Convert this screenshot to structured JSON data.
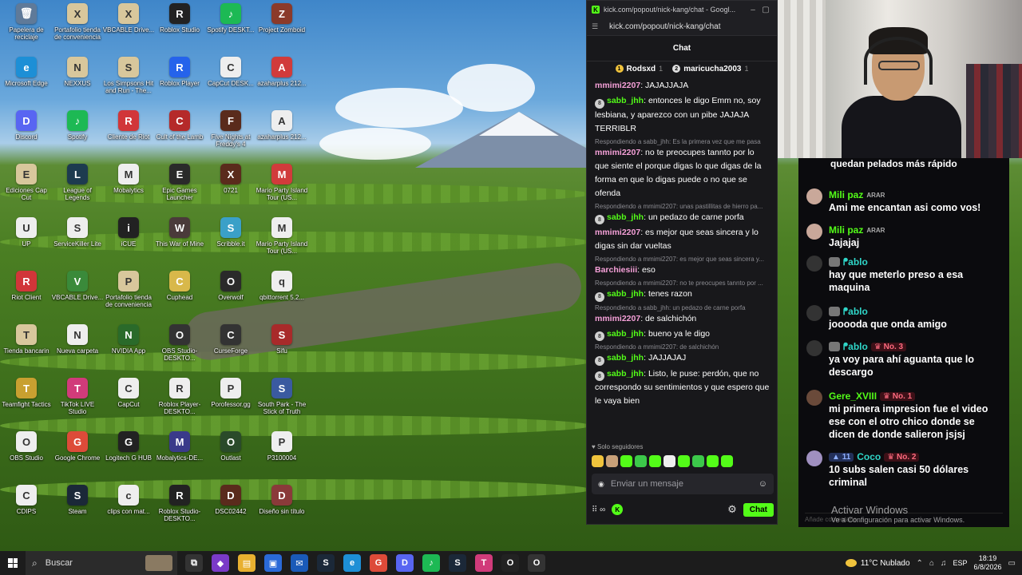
{
  "desktop": {
    "icons": [
      {
        "label": "Papelera de reciclaje",
        "glyph": "🗑",
        "color": "#5f7a99"
      },
      {
        "label": "Portafolio tienda de conveniencia",
        "glyph": "X",
        "color": "#d8c79c"
      },
      {
        "label": "VBCABLE Drive...",
        "glyph": "X",
        "color": "#d8c79c"
      },
      {
        "label": "Roblox Studio",
        "glyph": "R",
        "color": "#222"
      },
      {
        "label": "Spotify DESKT...",
        "glyph": "♪",
        "color": "#1db954"
      },
      {
        "label": "Project Zomboid",
        "glyph": "Z",
        "color": "#8b3a2a"
      },
      {
        "label": "Microsoft Edge",
        "glyph": "e",
        "color": "#1d8fd6"
      },
      {
        "label": "NEXXUS",
        "glyph": "N",
        "color": "#d8c79c"
      },
      {
        "label": "Los Simpsons Hit and Run - The...",
        "glyph": "S",
        "color": "#d8c79c"
      },
      {
        "label": "Roblox Player",
        "glyph": "R",
        "color": "#2563eb"
      },
      {
        "label": "CapCut DESK...",
        "glyph": "C",
        "color": "#eee"
      },
      {
        "label": "azaharplus 212...",
        "glyph": "A",
        "color": "#d13b3b"
      },
      {
        "label": "Discord",
        "glyph": "D",
        "color": "#5865f2"
      },
      {
        "label": "Spotify",
        "glyph": "♪",
        "color": "#1db954"
      },
      {
        "label": "Cliente de Riot",
        "glyph": "R",
        "color": "#d13639"
      },
      {
        "label": "Cult of the Lamb",
        "glyph": "C",
        "color": "#b52a2a"
      },
      {
        "label": "Five Nights at Freddy's 4",
        "glyph": "F",
        "color": "#5a2b1c"
      },
      {
        "label": "azaharplus 212...",
        "glyph": "A",
        "color": "#eee"
      },
      {
        "label": "Ediciones Cap Cut",
        "glyph": "E",
        "color": "#d8c79c"
      },
      {
        "label": "League of Legends",
        "glyph": "L",
        "color": "#1d3b4f"
      },
      {
        "label": "Mobalytics",
        "glyph": "M",
        "color": "#eee"
      },
      {
        "label": "Epic Games Launcher",
        "glyph": "E",
        "color": "#2a2a2a"
      },
      {
        "label": "0721",
        "glyph": "X",
        "color": "#5a2b1c"
      },
      {
        "label": "Mario Party Island Tour (US...",
        "glyph": "M",
        "color": "#d13b3b"
      },
      {
        "label": "UP",
        "glyph": "U",
        "color": "#eee"
      },
      {
        "label": "ServiceKiller Lite",
        "glyph": "S",
        "color": "#eee"
      },
      {
        "label": "iCUE",
        "glyph": "i",
        "color": "#222"
      },
      {
        "label": "This War of Mine",
        "glyph": "W",
        "color": "#4a3a3a"
      },
      {
        "label": "Scribble.it",
        "glyph": "S",
        "color": "#3aa0c8"
      },
      {
        "label": "Mario Party Island Tour (US...",
        "glyph": "M",
        "color": "#eee"
      },
      {
        "label": "Riot Client",
        "glyph": "R",
        "color": "#d13639"
      },
      {
        "label": "VBCABLE Drive...",
        "glyph": "V",
        "color": "#3a8a3a"
      },
      {
        "label": "Portafolio tienda de conveniencia",
        "glyph": "P",
        "color": "#d8c79c"
      },
      {
        "label": "Cuphead",
        "glyph": "C",
        "color": "#d8b84a"
      },
      {
        "label": "Overwolf",
        "glyph": "O",
        "color": "#2a2a2a"
      },
      {
        "label": "qbittorrent 5.2...",
        "glyph": "q",
        "color": "#eee"
      },
      {
        "label": "Tienda bancarin",
        "glyph": "T",
        "color": "#d8c79c"
      },
      {
        "label": "Nueva carpeta",
        "glyph": "N",
        "color": "#eee"
      },
      {
        "label": "NVIDIA App",
        "glyph": "N",
        "color": "#2a6a2a"
      },
      {
        "label": "OBS Studio-DESKTO...",
        "glyph": "O",
        "color": "#333"
      },
      {
        "label": "CurseForge",
        "glyph": "C",
        "color": "#333"
      },
      {
        "label": "Sifu",
        "glyph": "S",
        "color": "#a82a2a"
      },
      {
        "label": "Teamfight Tactics",
        "glyph": "T",
        "color": "#c8a030"
      },
      {
        "label": "TikTok LIVE Studio",
        "glyph": "T",
        "color": "#d13b7a"
      },
      {
        "label": "CapCut",
        "glyph": "C",
        "color": "#eee"
      },
      {
        "label": "Roblox Player-DESKTO...",
        "glyph": "R",
        "color": "#eee"
      },
      {
        "label": "Porofessor.gg",
        "glyph": "P",
        "color": "#eee"
      },
      {
        "label": "South Park - The Stick of Truth",
        "glyph": "S",
        "color": "#3a5aa0"
      },
      {
        "label": "OBS Studio",
        "glyph": "O",
        "color": "#eee"
      },
      {
        "label": "Google Chrome",
        "glyph": "G",
        "color": "#dd4b39"
      },
      {
        "label": "Logitech G HUB",
        "glyph": "G",
        "color": "#222"
      },
      {
        "label": "Mobalytics-DE...",
        "glyph": "M",
        "color": "#3a3a8a"
      },
      {
        "label": "Outlast",
        "glyph": "O",
        "color": "#2a4a2a"
      },
      {
        "label": "P3100004",
        "glyph": "P",
        "color": "#eee"
      },
      {
        "label": "CDIPS",
        "glyph": "C",
        "color": "#eee"
      },
      {
        "label": "Steam",
        "glyph": "S",
        "color": "#1b2838"
      },
      {
        "label": "clips con mat...",
        "glyph": "c",
        "color": "#eee"
      },
      {
        "label": "Roblox Studio-DESKTO...",
        "glyph": "R",
        "color": "#222"
      },
      {
        "label": "DSC02442",
        "glyph": "D",
        "color": "#5a2b1c"
      },
      {
        "label": "Diseño sin título",
        "glyph": "D",
        "color": "#8a3a3a"
      }
    ]
  },
  "kick_window": {
    "title": "kick.com/popout/nick-kang/chat - Googl...",
    "url": "kick.com/popout/nick-kang/chat",
    "header": "Chat",
    "pinned": [
      {
        "name": "Rodsxd",
        "count": "1",
        "color": "#f0c33c",
        "glyph": "1"
      },
      {
        "name": "maricucha2003",
        "count": "1",
        "color": "#e0e0e0",
        "glyph": "2"
      }
    ],
    "messages": [
      {
        "reply": "",
        "badge": "",
        "user": "mmimi2207",
        "user_color": "#f5a0d8",
        "text": "JAJAJJAJA"
      },
      {
        "reply": "",
        "badge": "8",
        "user": "sabb_jhh",
        "user_color": "#53fc18",
        "text": "entonces le digo Emm no, soy lesbiana, y aparezco con un pibe JAJAJA TERRIBLR"
      },
      {
        "reply": "Respondiendo a sabb_jhh: Es la primera vez que me pasa",
        "badge": "",
        "user": "mmimi2207",
        "user_color": "#f5a0d8",
        "text": "no te preocupes tannto por lo que siente el porque digas lo que digas de la forma en que lo digas puede o no que se ofenda"
      },
      {
        "reply": "Respondiendo a mmimi2207: unas pastillitas de hierro pa...",
        "badge": "8",
        "user": "sabb_jhh",
        "user_color": "#53fc18",
        "text": "un pedazo de carne porfa"
      },
      {
        "reply": "",
        "badge": "",
        "user": "mmimi2207",
        "user_color": "#f5a0d8",
        "text": "es mejor que seas sincera y lo digas sin dar vueltas"
      },
      {
        "reply": "Respondiendo a mmimi2207: es mejor que seas sincera y...",
        "badge": "",
        "user": "Barchiesiii",
        "user_color": "#f5a0d8",
        "text": "eso"
      },
      {
        "reply": "Respondiendo a mmimi2207: no te preocupes tannto por ...",
        "badge": "8",
        "user": "sabb_jhh",
        "user_color": "#53fc18",
        "text": "tenes razon"
      },
      {
        "reply": "Respondiendo a sabb_jhh: un pedazo de carne porfa",
        "badge": "",
        "user": "mmimi2207",
        "user_color": "#f5a0d8",
        "text": "de salchichón"
      },
      {
        "reply": "",
        "badge": "8",
        "user": "sabb_jhh",
        "user_color": "#53fc18",
        "text": "bueno ya le digo"
      },
      {
        "reply": "Respondiendo a mmimi2207: de salchichón",
        "badge": "8",
        "user": "sabb_jhh",
        "user_color": "#53fc18",
        "text": "JAJJAJAJ"
      },
      {
        "reply": "",
        "badge": "8",
        "user": "sabb_jhh",
        "user_color": "#53fc18",
        "text": "Listo, le puse: perdón, que no correspondo su sentimientos y que espero que le vaya bien"
      }
    ],
    "followers_only": "Solo seguidores",
    "emote_colors": [
      "#f0c33c",
      "#c8a078",
      "#53fc18",
      "#3cc84a",
      "#53fc18",
      "#eee",
      "#53fc18",
      "#3cc84a",
      "#53fc18",
      "#53fc18"
    ],
    "input_placeholder": "Enviar un mensaje",
    "chat_button": "Chat",
    "bottom_icons": "⠿ ∞"
  },
  "overlay": {
    "top_text": "quedan pelados más rápido",
    "messages": [
      {
        "user": "Mili paz",
        "user_color": "#53fc18",
        "tag": "ARAR",
        "rank": "",
        "subs": "",
        "gray": false,
        "avatar": "#c9a89a",
        "text": "Ami me encantan asi como vos!"
      },
      {
        "user": "Mili paz",
        "user_color": "#53fc18",
        "tag": "ARAR",
        "rank": "",
        "subs": "",
        "gray": false,
        "avatar": "#c9a89a",
        "text": "Jajajaj"
      },
      {
        "user": "ᖰablo",
        "user_color": "#2fd6c8",
        "tag": "",
        "rank": "",
        "subs": "",
        "gray": true,
        "avatar": "#333",
        "text": "hay que meterlo preso a esa maquina"
      },
      {
        "user": "ᖰablo",
        "user_color": "#2fd6c8",
        "tag": "",
        "rank": "",
        "subs": "",
        "gray": true,
        "avatar": "#333",
        "text": "jooooda que onda amigo"
      },
      {
        "user": "ᖰablo",
        "user_color": "#2fd6c8",
        "tag": "",
        "rank": "No. 3",
        "subs": "",
        "gray": true,
        "avatar": "#333",
        "text": "ya voy para ahí aguanta que lo descargo"
      },
      {
        "user": "Gere_XVIII",
        "user_color": "#53fc18",
        "tag": "",
        "rank": "No. 1",
        "subs": "",
        "gray": false,
        "avatar": "#6a4a3a",
        "text": "mi primera impresion fue el video ese con el otro chico donde se dicen de donde salieron jsjsj"
      },
      {
        "user": "Coco",
        "user_color": "#2fd6c8",
        "tag": "",
        "rank": "No. 2",
        "subs": "11",
        "gray": false,
        "avatar": "#a090c0",
        "text": "10 subs salen casi 50 dólares criminal"
      }
    ],
    "footer": "Añade comentario..."
  },
  "activate_windows": {
    "line1": "Activar Windows",
    "line2": "Ve a Configuración para activar Windows."
  },
  "taskbar": {
    "search_label": "Buscar",
    "apps": [
      {
        "glyph": "⧉",
        "color": "#333"
      },
      {
        "glyph": "◆",
        "color": "#7a3ac8"
      },
      {
        "glyph": "▤",
        "color": "#e8b030"
      },
      {
        "glyph": "▣",
        "color": "#2a6ad8"
      },
      {
        "glyph": "✉",
        "color": "#1a5ab8"
      },
      {
        "glyph": "S",
        "color": "#1b2838"
      },
      {
        "glyph": "e",
        "color": "#1d8fd6"
      },
      {
        "glyph": "G",
        "color": "#dd4b39"
      },
      {
        "glyph": "D",
        "color": "#5865f2"
      },
      {
        "glyph": "♪",
        "color": "#1db954"
      },
      {
        "glyph": "S",
        "color": "#1b2838"
      },
      {
        "glyph": "T",
        "color": "#d13b7a"
      },
      {
        "glyph": "O",
        "color": "#222"
      },
      {
        "glyph": "O",
        "color": "#333"
      }
    ],
    "weather": "11°C  Nublado",
    "language": "ESP",
    "time": "18:19",
    "date": "6/8/2026"
  }
}
